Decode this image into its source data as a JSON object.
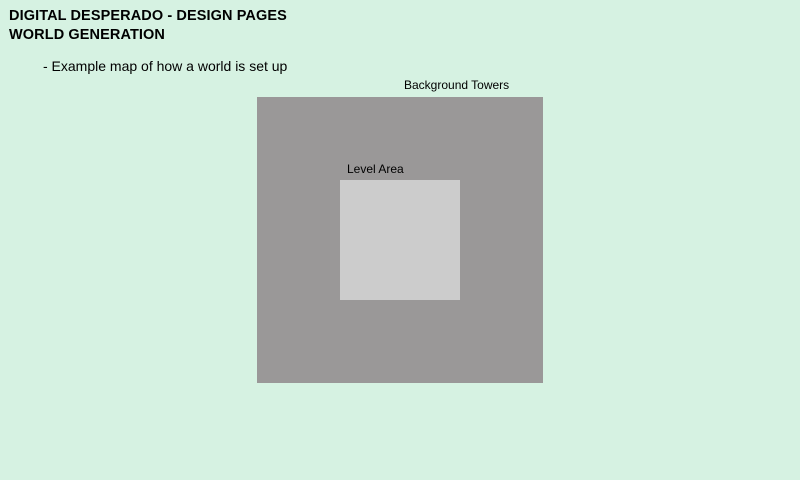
{
  "header": {
    "title_line1": "DIGITAL DESPERADO - DESIGN PAGES",
    "title_line2": "WORLD GENERATION"
  },
  "description": "- Example map of how a world is set up",
  "diagram": {
    "outer_label": "Background Towers",
    "inner_label": "Level Area",
    "colors": {
      "page_background": "#d6f2e2",
      "background_towers": "#9a9898",
      "level_area": "#cccccc"
    }
  }
}
